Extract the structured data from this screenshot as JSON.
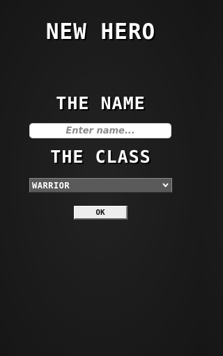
{
  "screen": {
    "title": "NEW HERO"
  },
  "form": {
    "name_label": "THE NAME",
    "name_value": "",
    "name_placeholder": "Enter name...",
    "class_label": "THE CLASS",
    "class_selected": "WARRIOR",
    "ok_label": "OK"
  },
  "icons": {
    "dropdown": "chevron-down-icon"
  },
  "colors": {
    "background": "#1b1b1b",
    "text": "#ffffff",
    "input_bg": "#ffffff",
    "select_bg": "#5a5a5a",
    "button_bg": "#ececec"
  }
}
